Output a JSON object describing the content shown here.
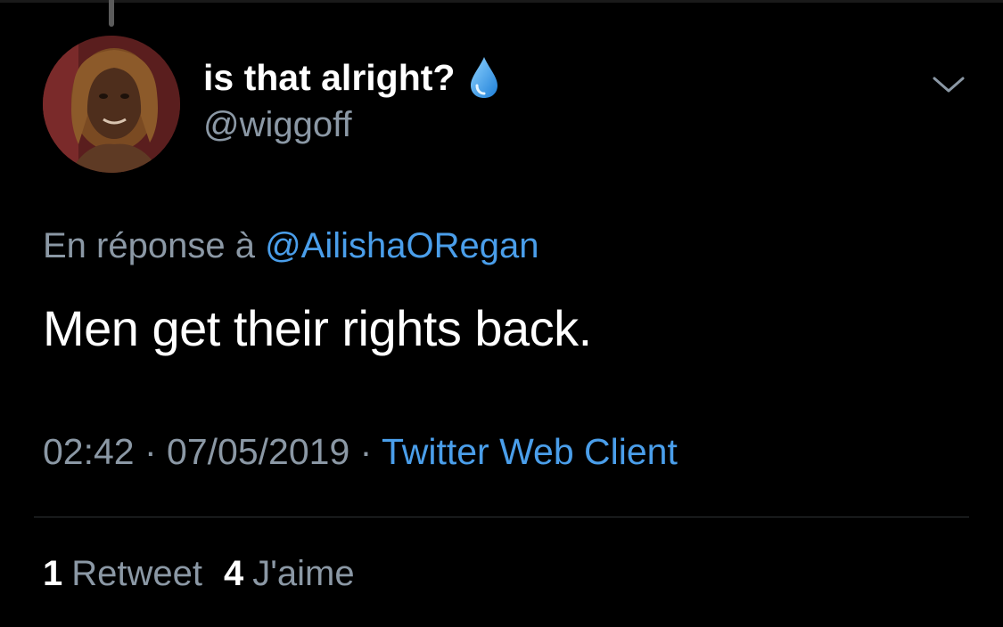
{
  "tweet": {
    "display_name": "is that alright?",
    "handle": "@wiggoff",
    "emoji_icon": "droplet-icon",
    "reply_prefix": "En réponse à",
    "reply_mention": "@AilishaORegan",
    "text": "Men get their rights back.",
    "time": "02:42",
    "separator": " · ",
    "date": "07/05/2019",
    "source": "Twitter Web Client",
    "stats": {
      "retweets_count": "1",
      "retweets_label": "Retweet",
      "likes_count": "4",
      "likes_label": "J'aime"
    }
  },
  "colors": {
    "background": "#000000",
    "primary_text": "#ffffff",
    "secondary_text": "#8b98a5",
    "link": "#4a9eea",
    "divider": "#2f3336"
  }
}
